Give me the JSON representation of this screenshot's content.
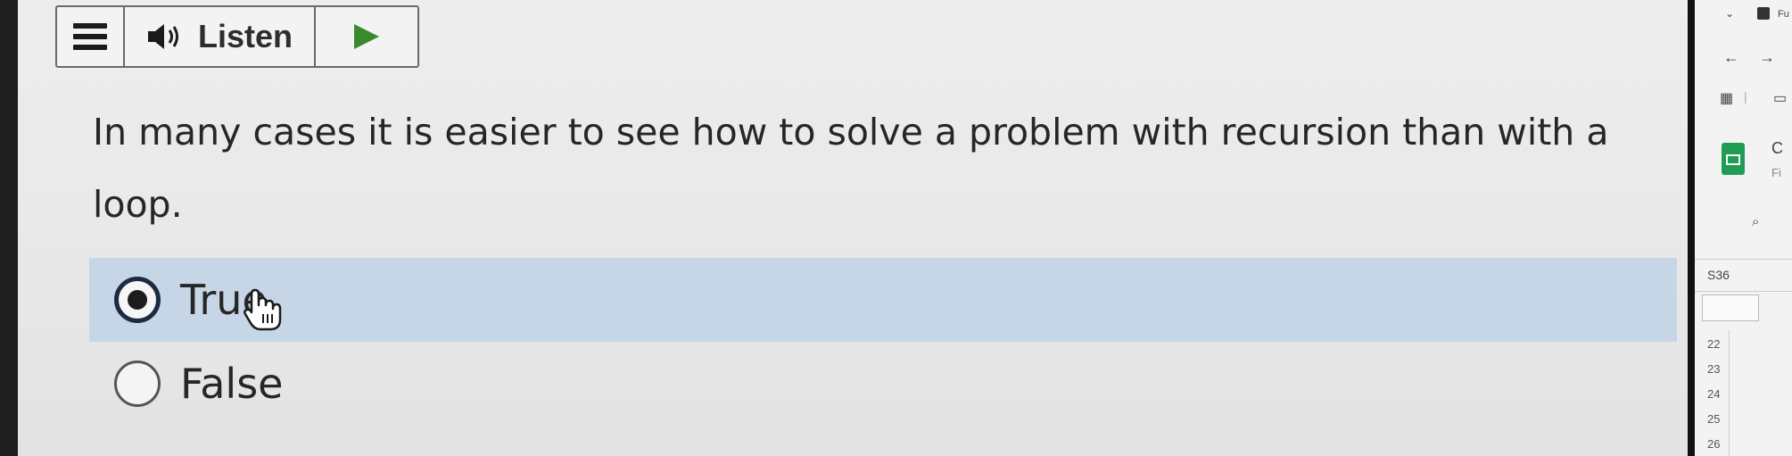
{
  "toolbar": {
    "listen_label": "Listen",
    "menu_icon": "hamburger-menu-icon",
    "speaker_icon": "speaker-icon",
    "play_icon": "play-triangle-icon"
  },
  "question": {
    "text": "In many cases it is easier to see how to solve a problem with recursion than with a loop."
  },
  "options": [
    {
      "label": "True",
      "selected": true
    },
    {
      "label": "False",
      "selected": false
    }
  ],
  "colors": {
    "selected_row": "#c7d6e6",
    "text": "#262626",
    "play_green": "#3a8a2c"
  },
  "side_window": {
    "cell_ref": "S36",
    "letter_c": "C",
    "text_fi": "Fi",
    "text_fu": "Fu",
    "row_numbers": [
      "22",
      "23",
      "24",
      "25",
      "26"
    ]
  }
}
